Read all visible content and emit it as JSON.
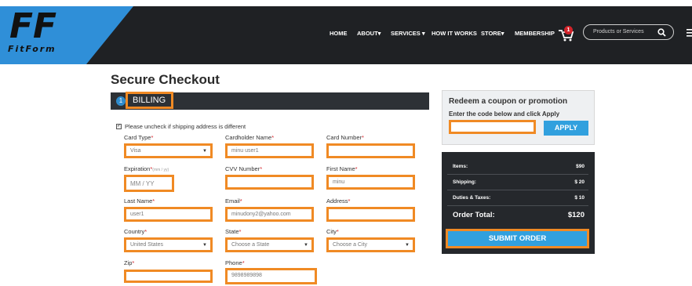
{
  "header": {
    "logo_text": "FitForm",
    "nav": [
      "HOME",
      "ABOUT▾",
      "SERVICES ▾",
      "HOW IT WORKS",
      "STORE▾",
      "MEMBERSHIP"
    ],
    "cart_count": "1",
    "search_placeholder": "Products or Services"
  },
  "page": {
    "title": "Secure Checkout"
  },
  "billing": {
    "step": "1",
    "label": "BILLING",
    "checkbox_label": "Please uncheck if shipping address is different"
  },
  "fields": {
    "card_type": {
      "label": "Card Type",
      "value": "Visa"
    },
    "cardholder": {
      "label": "Cardholder Name",
      "value": "minu user1"
    },
    "card_number": {
      "label": "Card Number",
      "value": ""
    },
    "expiration": {
      "label": "Expiration",
      "hint": "(mm / yy)",
      "value": "MM  /  YY"
    },
    "cvv": {
      "label": "CVV Number",
      "value": ""
    },
    "first_name": {
      "label": "First Name",
      "value": "minu"
    },
    "last_name": {
      "label": "Last Name",
      "value": "user1"
    },
    "email": {
      "label": "Email",
      "value": "minudony2@yahoo.com"
    },
    "address": {
      "label": "Address",
      "value": ""
    },
    "country": {
      "label": "Country",
      "value": "United States"
    },
    "state": {
      "label": "State",
      "value": "Choose a State"
    },
    "city": {
      "label": "City",
      "value": "Choose a City"
    },
    "zip": {
      "label": "Zip",
      "value": ""
    },
    "phone": {
      "label": "Phone",
      "value": "9898989898"
    }
  },
  "coupon": {
    "title": "Redeem a coupon or promotion",
    "subtitle": "Enter the code below and click Apply",
    "apply_label": "APPLY"
  },
  "summary": {
    "items_label": "Items:",
    "items_value": "$90",
    "shipping_label": "Shipping:",
    "shipping_value": "$ 20",
    "duties_label": "Duties & Taxes:",
    "duties_value": "$ 10",
    "total_label": "Order Total:",
    "total_value": "$120",
    "submit_label": "SUBMIT ORDER"
  },
  "colors": {
    "highlight": "#f08a24",
    "accent": "#31a0de",
    "dark": "#25282c"
  }
}
